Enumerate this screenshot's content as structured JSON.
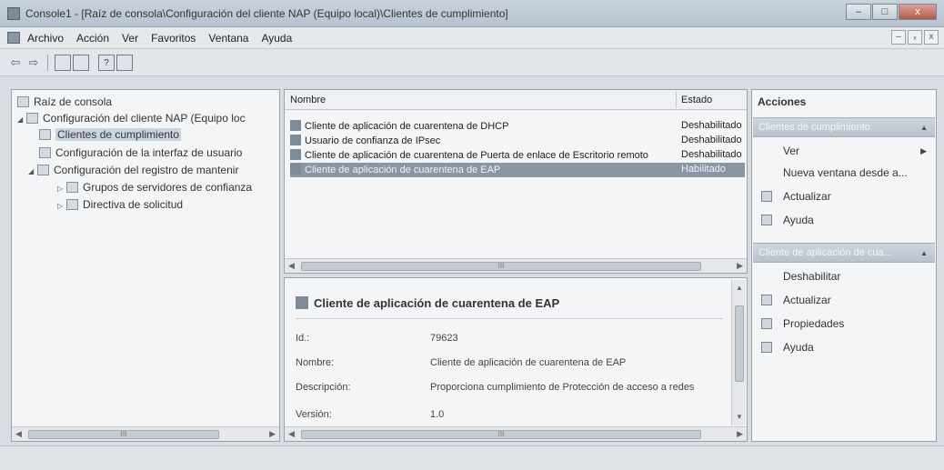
{
  "window": {
    "title": "Console1 - [Raíz de consola\\Configuración del cliente NAP (Equipo local)\\Clientes de cumplimiento]",
    "minimize": "–",
    "maximize": "□",
    "close": "x"
  },
  "menubar": {
    "items": [
      "Archivo",
      "Acción",
      "Ver",
      "Favoritos",
      "Ventana",
      "Ayuda"
    ],
    "mdi_minimize": "–",
    "mdi_restore": "ₓ",
    "mdi_close": "x"
  },
  "toolbar": {
    "back": "⇦",
    "forward": "⇨",
    "help_box": "?"
  },
  "tree": {
    "root": "Raíz de consola",
    "nap": "Configuración del cliente NAP (Equipo loc",
    "clientes": "Clientes de cumplimiento",
    "interfaz": "Configuración de la interfaz de usuario",
    "registro": "Configuración del registro de mantenir",
    "grupos": "Grupos de servidores de confianza",
    "directiva": "Directiva de solicitud",
    "scroll_thumb": "III"
  },
  "list": {
    "col_name": "Nombre",
    "col_state": "Estado",
    "rows": [
      {
        "name": "Cliente de aplicación de cuarentena de DHCP",
        "state": "Deshabilitado"
      },
      {
        "name": "Usuario de confianza de IPsec",
        "state": "Deshabilitado"
      },
      {
        "name": "Cliente de aplicación de cuarentena de Puerta de enlace de Escritorio remoto",
        "state": "Deshabilitado"
      },
      {
        "name": "Cliente de aplicación de cuarentena de EAP",
        "state": "Habilitado"
      }
    ],
    "scroll_thumb": "III"
  },
  "detail": {
    "title": "Cliente de aplicación de cuarentena de EAP",
    "props": [
      {
        "label": "Id.:",
        "value": "79623"
      },
      {
        "label": "Nombre:",
        "value": "Cliente de aplicación de cuarentena de EAP"
      },
      {
        "label": "Descripción:",
        "value": "Proporciona cumplimiento de Protección de acceso a redes"
      },
      {
        "label": "Versión:",
        "value": "1.0"
      }
    ],
    "scroll_thumb": "III"
  },
  "actions": {
    "title": "Acciones",
    "section1": "Clientes de cumplimiento",
    "section1_items": [
      "Ver",
      "Nueva ventana desde a...",
      "Actualizar",
      "Ayuda"
    ],
    "section2": "Cliente de aplicación de cua...",
    "section2_items": [
      "Deshabilitar",
      "Actualizar",
      "Propiedades",
      "Ayuda"
    ]
  }
}
